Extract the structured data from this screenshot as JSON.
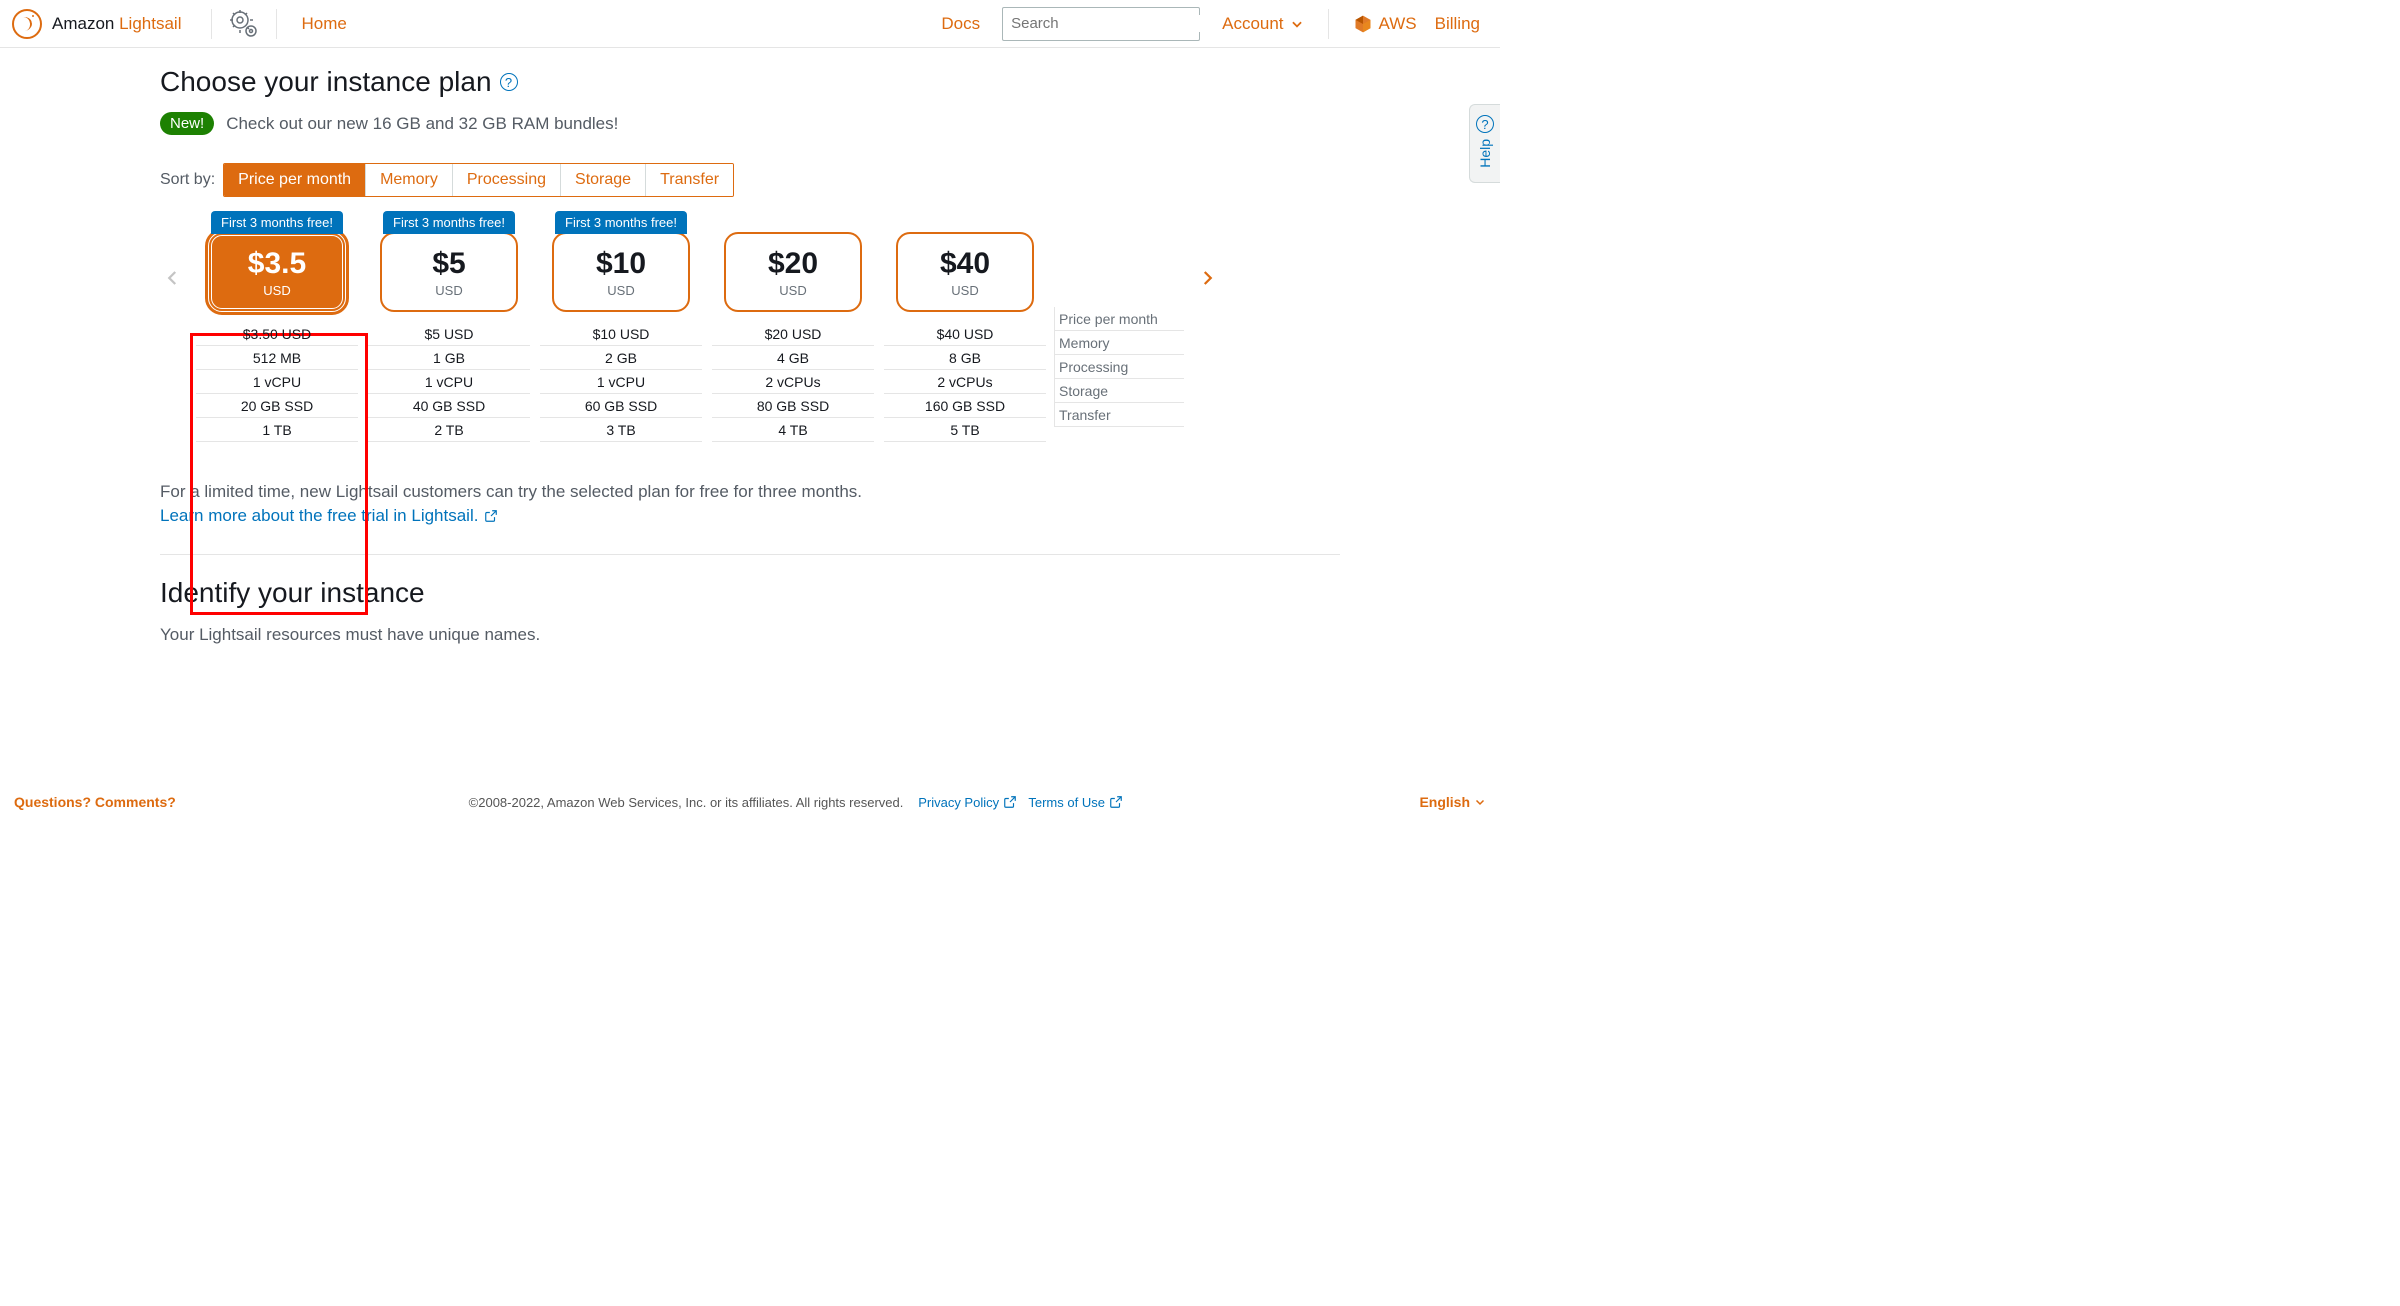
{
  "header": {
    "brand_prefix": "Amazon ",
    "brand_suffix": "Lightsail",
    "home": "Home",
    "docs": "Docs",
    "search_placeholder": "Search",
    "account": "Account",
    "aws": "AWS",
    "billing": "Billing"
  },
  "title": "Choose your instance plan",
  "banner": {
    "new": "New!",
    "text": "Check out our new 16 GB and 32 GB RAM bundles!"
  },
  "sort": {
    "label": "Sort by:",
    "tabs": [
      "Price per month",
      "Memory",
      "Processing",
      "Storage",
      "Transfer"
    ]
  },
  "free_label": "First 3 months free!",
  "plans": [
    {
      "price": "$3.5",
      "currency": "USD",
      "selected": true,
      "free": true,
      "specs": [
        "$3.50 USD",
        "512 MB",
        "1 vCPU",
        "20 GB SSD",
        "1 TB"
      ]
    },
    {
      "price": "$5",
      "currency": "USD",
      "selected": false,
      "free": true,
      "specs": [
        "$5 USD",
        "1 GB",
        "1 vCPU",
        "40 GB SSD",
        "2 TB"
      ]
    },
    {
      "price": "$10",
      "currency": "USD",
      "selected": false,
      "free": true,
      "specs": [
        "$10 USD",
        "2 GB",
        "1 vCPU",
        "60 GB SSD",
        "3 TB"
      ]
    },
    {
      "price": "$20",
      "currency": "USD",
      "selected": false,
      "free": false,
      "specs": [
        "$20 USD",
        "4 GB",
        "2 vCPUs",
        "80 GB SSD",
        "4 TB"
      ]
    },
    {
      "price": "$40",
      "currency": "USD",
      "selected": false,
      "free": false,
      "specs": [
        "$40 USD",
        "8 GB",
        "2 vCPUs",
        "160 GB SSD",
        "5 TB"
      ]
    }
  ],
  "spec_labels": [
    "Price per month",
    "Memory",
    "Processing",
    "Storage",
    "Transfer"
  ],
  "promo_text": "For a limited time, new Lightsail customers can try the selected plan for free for three months.",
  "learn_more": "Learn more about the free trial in Lightsail.",
  "identify": {
    "heading": "Identify your instance",
    "sub": "Your Lightsail resources must have unique names."
  },
  "help_tab": "Help",
  "footer": {
    "questions": "Questions? Comments?",
    "copyright": "©2008-2022, Amazon Web Services, Inc. or its affiliates. All rights reserved.",
    "privacy": "Privacy Policy",
    "terms": "Terms of Use",
    "language": "English"
  }
}
